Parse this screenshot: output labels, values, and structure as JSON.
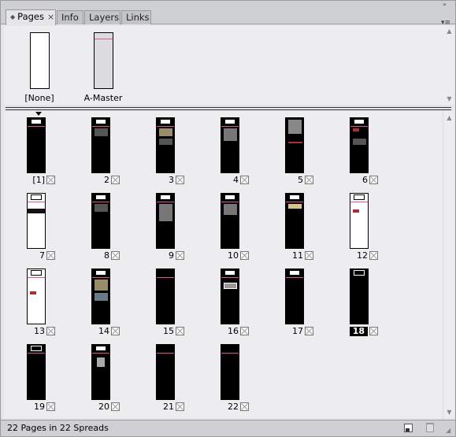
{
  "tabs": [
    {
      "label": "Pages",
      "active": true
    },
    {
      "label": "Info",
      "active": false
    },
    {
      "label": "Layers",
      "active": false
    },
    {
      "label": "Links",
      "active": false
    }
  ],
  "masters": [
    {
      "label": "[None]"
    },
    {
      "label": "A-Master"
    }
  ],
  "pages": [
    {
      "label": "[1]"
    },
    {
      "label": "2"
    },
    {
      "label": "3"
    },
    {
      "label": "4"
    },
    {
      "label": "5"
    },
    {
      "label": "6"
    },
    {
      "label": "7"
    },
    {
      "label": "8"
    },
    {
      "label": "9"
    },
    {
      "label": "10"
    },
    {
      "label": "11"
    },
    {
      "label": "12"
    },
    {
      "label": "13"
    },
    {
      "label": "14"
    },
    {
      "label": "15"
    },
    {
      "label": "16"
    },
    {
      "label": "17"
    },
    {
      "label": "18"
    },
    {
      "label": "19"
    },
    {
      "label": "20"
    },
    {
      "label": "21"
    },
    {
      "label": "22"
    }
  ],
  "selected_page": "18",
  "footer": {
    "status": "22 Pages in 22 Spreads"
  },
  "colors": {
    "master_guide": "#e0559a",
    "panel_bg": "#e6e6ea"
  },
  "icons": {
    "collapse": "double-chevron-right-icon",
    "panel_menu": "panel-menu-icon",
    "new_page": "new-page-icon",
    "delete": "trash-icon",
    "transparency": "transparency-icon"
  }
}
